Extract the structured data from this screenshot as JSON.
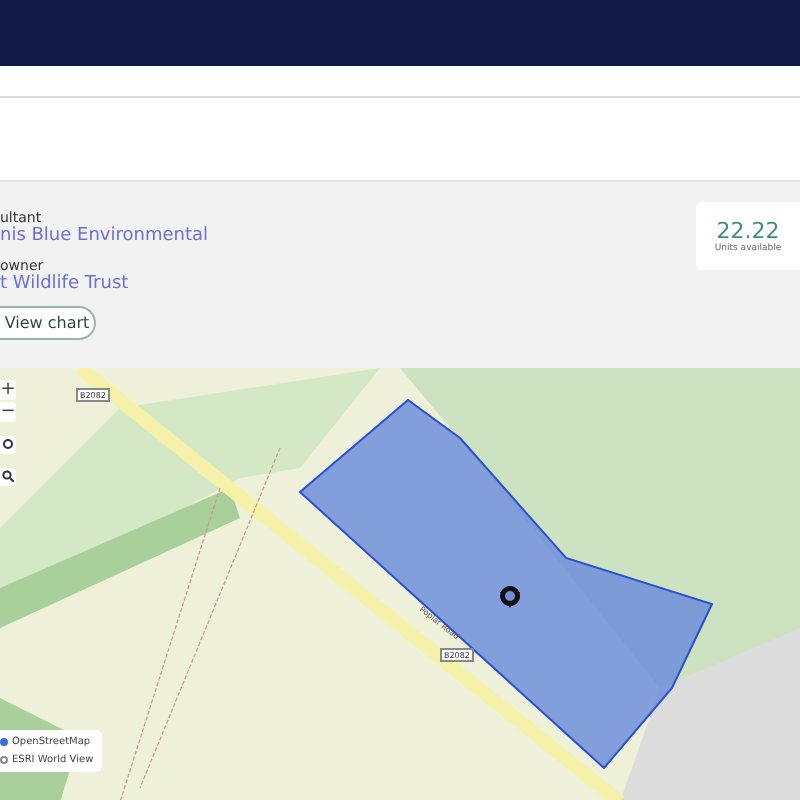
{
  "details": {
    "consultant_label": "ultant",
    "consultant": "nis Blue Environmental",
    "owner_label": "owner",
    "owner": "t Wildlife Trust",
    "button": "View chart"
  },
  "units": {
    "value": "22.22",
    "label": "Units available"
  },
  "map": {
    "zoom_in": "+",
    "zoom_out": "−",
    "road_labels": [
      {
        "text": "B2082",
        "kind": "shield"
      },
      {
        "text": "Poplar Road",
        "kind": "street"
      },
      {
        "text": "B2082",
        "kind": "shield"
      }
    ],
    "layers": [
      {
        "label": "OpenStreetMap",
        "selected": true
      },
      {
        "label": "ESRI World View",
        "selected": false
      }
    ]
  }
}
